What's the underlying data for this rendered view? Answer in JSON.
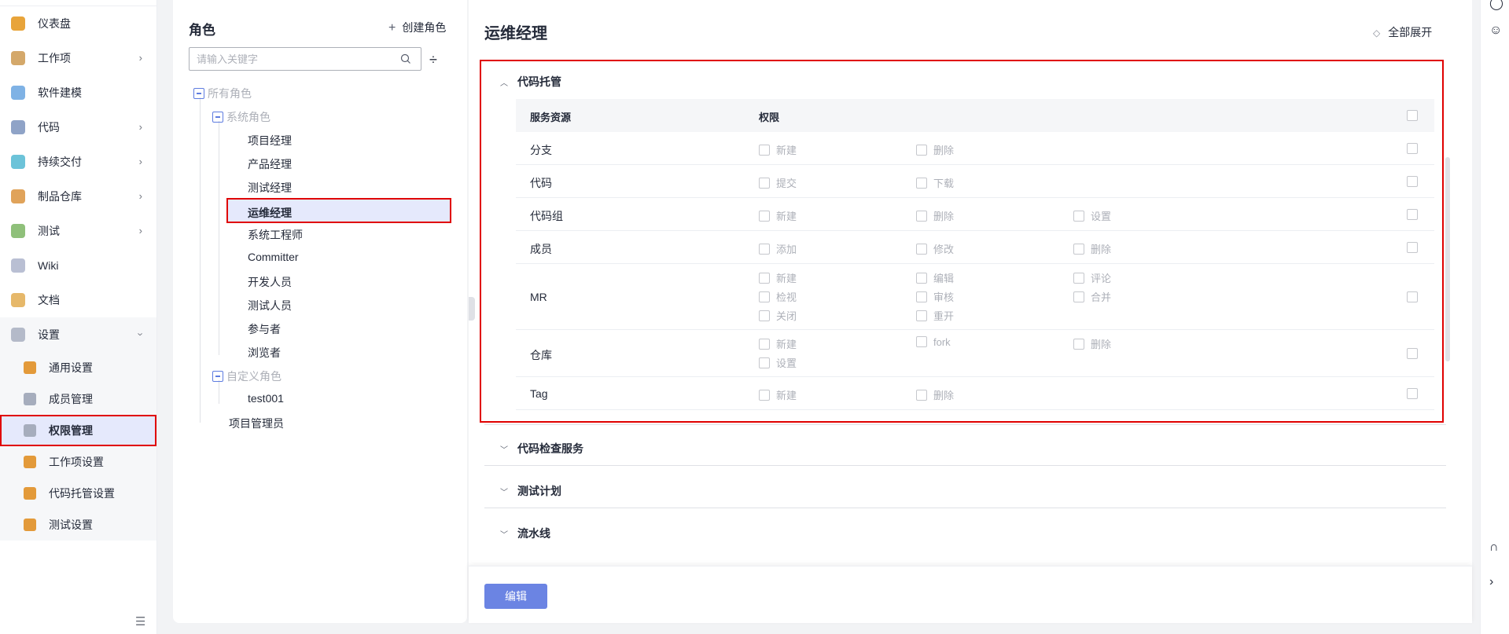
{
  "sidebar": {
    "items": [
      {
        "label": "仪表盘",
        "icon": "dashboard-icon",
        "color": "#e8a43a",
        "chevron": false
      },
      {
        "label": "工作项",
        "icon": "workitem-icon",
        "color": "#d4a86a",
        "chevron": true
      },
      {
        "label": "软件建模",
        "icon": "modeling-icon",
        "color": "#7fb2e5",
        "chevron": false
      },
      {
        "label": "代码",
        "icon": "code-icon",
        "color": "#8fa3c7",
        "chevron": true
      },
      {
        "label": "持续交付",
        "icon": "delivery-icon",
        "color": "#6cc3d9",
        "chevron": true
      },
      {
        "label": "制品仓库",
        "icon": "artifact-icon",
        "color": "#e0a35a",
        "chevron": true
      },
      {
        "label": "测试",
        "icon": "test-icon",
        "color": "#8fc07a",
        "chevron": true
      },
      {
        "label": "Wiki",
        "icon": "wiki-icon",
        "color": "#b9bfd3",
        "chevron": false
      },
      {
        "label": "文档",
        "icon": "document-icon",
        "color": "#e6b86a",
        "chevron": false
      }
    ],
    "settings": {
      "label": "设置",
      "icon": "settings-icon",
      "sub_items": [
        {
          "label": "通用设置",
          "icon": "general-settings-icon",
          "color": "#e39a3a"
        },
        {
          "label": "成员管理",
          "icon": "member-manage-icon",
          "color": "#a6adbd"
        },
        {
          "label": "权限管理",
          "icon": "permission-manage-icon",
          "color": "#a6adbd"
        },
        {
          "label": "工作项设置",
          "icon": "workitem-settings-icon",
          "color": "#e39a3a"
        },
        {
          "label": "代码托管设置",
          "icon": "code-hosting-settings-icon",
          "color": "#e39a3a"
        },
        {
          "label": "测试设置",
          "icon": "test-settings-icon",
          "color": "#e39a3a"
        }
      ]
    }
  },
  "role_panel": {
    "title": "角色",
    "create_label": "创建角色",
    "search_placeholder": "请输入关键字",
    "tree": {
      "all_roles": "所有角色",
      "system_roles": "系统角色",
      "system_children": [
        "项目经理",
        "产品经理",
        "测试经理",
        "运维经理",
        "系统工程师",
        "Committer",
        "开发人员",
        "测试人员",
        "参与者",
        "浏览者"
      ],
      "custom_roles": "自定义角色",
      "custom_children": [
        "test001"
      ],
      "project_admin": "项目管理员"
    },
    "selected_role": "运维经理"
  },
  "main": {
    "title": "运维经理",
    "expand_all": "全部展开",
    "sections": [
      {
        "label": "代码托管",
        "expanded": true
      },
      {
        "label": "代码检查服务",
        "expanded": false
      },
      {
        "label": "测试计划",
        "expanded": false
      },
      {
        "label": "流水线",
        "expanded": false
      }
    ],
    "table": {
      "col_resource": "服务资源",
      "col_permission": "权限",
      "rows": [
        {
          "resource": "分支",
          "perms": [
            "新建",
            "删除"
          ]
        },
        {
          "resource": "代码",
          "perms": [
            "提交",
            "下载"
          ]
        },
        {
          "resource": "代码组",
          "perms": [
            "新建",
            "删除",
            "设置"
          ]
        },
        {
          "resource": "成员",
          "perms": [
            "添加",
            "修改",
            "删除"
          ]
        },
        {
          "resource": "MR",
          "perms": [
            "新建",
            "编辑",
            "评论",
            "检视",
            "审核",
            "合并",
            "关闭",
            "重开"
          ]
        },
        {
          "resource": "仓库",
          "perms": [
            "新建",
            "fork",
            "删除",
            "设置"
          ]
        },
        {
          "resource": "Tag",
          "perms": [
            "新建",
            "删除"
          ]
        }
      ]
    },
    "edit_label": "编辑"
  },
  "colors": {
    "accent": "#5e7ce0",
    "highlight_border": "#e00000",
    "selected_bg": "#e5e9fc",
    "button": "#6b84e3"
  }
}
